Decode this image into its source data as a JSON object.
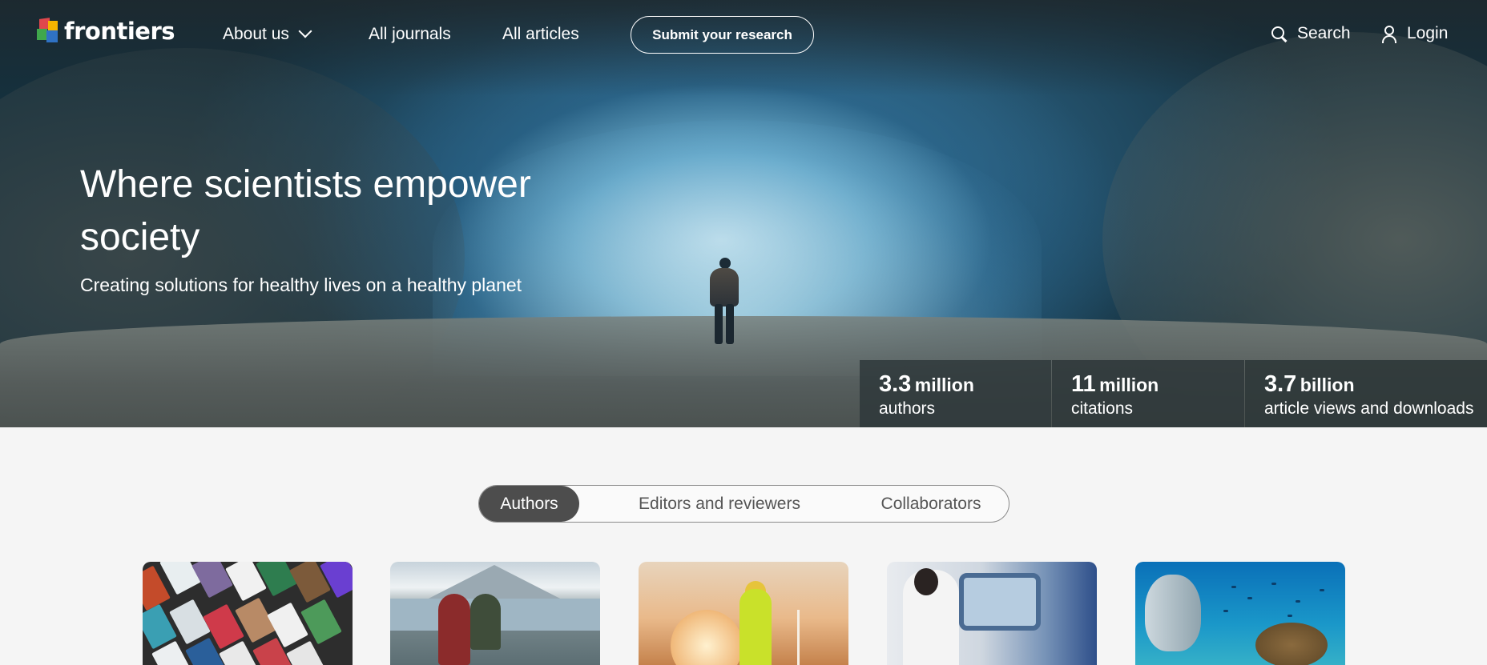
{
  "brand": {
    "name": "frontiers"
  },
  "nav": {
    "about_label": "About us",
    "journals_label": "All journals",
    "articles_label": "All articles",
    "submit_label": "Submit your research",
    "search_label": "Search",
    "login_label": "Login"
  },
  "hero": {
    "title": "Where scientists empower society",
    "subtitle": "Creating solutions for healthy lives on a healthy planet"
  },
  "stats": [
    {
      "number": "3.3",
      "unit": "million",
      "label": "authors"
    },
    {
      "number": "11",
      "unit": "million",
      "label": "citations"
    },
    {
      "number": "3.7",
      "unit": "billion",
      "label": "article views and downloads"
    }
  ],
  "tabs": {
    "selected": "Authors",
    "items": [
      {
        "label": "Authors"
      },
      {
        "label": "Editors and reviewers"
      },
      {
        "label": "Collaborators"
      }
    ]
  },
  "icons": {
    "search": "search-icon",
    "user": "user-icon",
    "chevron": "chevron-down-icon"
  },
  "colors": {
    "brand_red": "#e0474c",
    "brand_yellow": "#f7b500",
    "brand_green": "#3fa84c",
    "brand_blue": "#2f72c4",
    "tab_active_bg": "#4d4d4d",
    "page_bg": "#f5f5f5"
  }
}
